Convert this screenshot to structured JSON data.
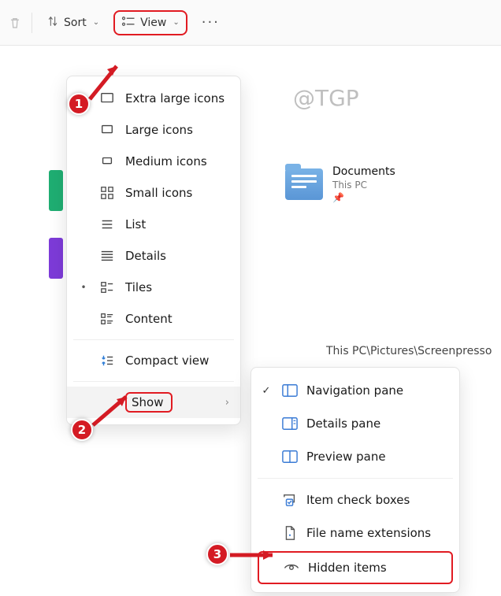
{
  "toolbar": {
    "sort_label": "Sort",
    "view_label": "View"
  },
  "watermark": "@TGP",
  "path_text": "This PC\\Pictures\\Screenpresso",
  "file_documents": {
    "name": "Documents",
    "sub": "This PC"
  },
  "view_menu": {
    "items": [
      {
        "label": "Extra large icons"
      },
      {
        "label": "Large icons"
      },
      {
        "label": "Medium icons"
      },
      {
        "label": "Small icons"
      },
      {
        "label": "List"
      },
      {
        "label": "Details"
      },
      {
        "label": "Tiles"
      },
      {
        "label": "Content"
      },
      {
        "label": "Compact view"
      }
    ],
    "show_label": "Show"
  },
  "show_submenu": {
    "items": [
      {
        "label": "Navigation pane",
        "checked": true
      },
      {
        "label": "Details pane",
        "checked": false
      },
      {
        "label": "Preview pane",
        "checked": false
      },
      {
        "label": "Item check boxes",
        "checked": false
      },
      {
        "label": "File name extensions",
        "checked": false
      },
      {
        "label": "Hidden items",
        "checked": false
      }
    ]
  },
  "callouts": {
    "c1": "1",
    "c2": "2",
    "c3": "3"
  }
}
